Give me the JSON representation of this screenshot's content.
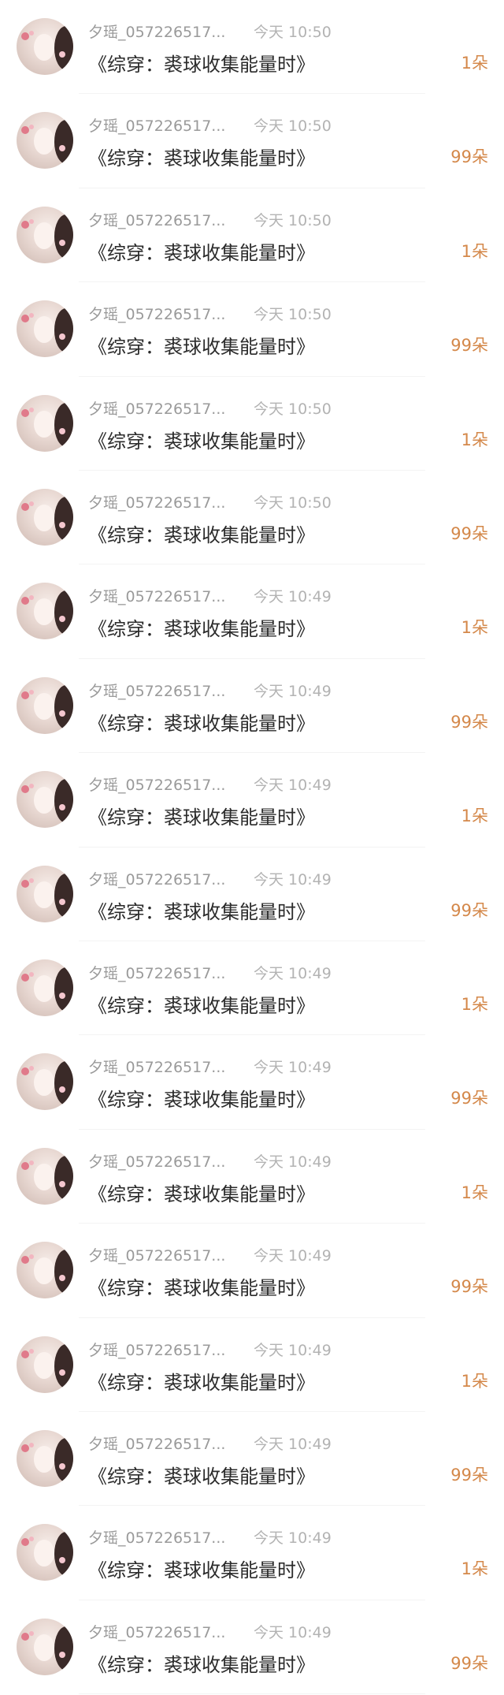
{
  "items": [
    {
      "username": "夕瑶_057226517...",
      "time": "今天 10:50",
      "title": "《综穿：裘球收集能量时》",
      "gift": "1朵"
    },
    {
      "username": "夕瑶_057226517...",
      "time": "今天 10:50",
      "title": "《综穿：裘球收集能量时》",
      "gift": "99朵"
    },
    {
      "username": "夕瑶_057226517...",
      "time": "今天 10:50",
      "title": "《综穿：裘球收集能量时》",
      "gift": "1朵"
    },
    {
      "username": "夕瑶_057226517...",
      "time": "今天 10:50",
      "title": "《综穿：裘球收集能量时》",
      "gift": "99朵"
    },
    {
      "username": "夕瑶_057226517...",
      "time": "今天 10:50",
      "title": "《综穿：裘球收集能量时》",
      "gift": "1朵"
    },
    {
      "username": "夕瑶_057226517...",
      "time": "今天 10:50",
      "title": "《综穿：裘球收集能量时》",
      "gift": "99朵"
    },
    {
      "username": "夕瑶_057226517...",
      "time": "今天 10:49",
      "title": "《综穿：裘球收集能量时》",
      "gift": "1朵"
    },
    {
      "username": "夕瑶_057226517...",
      "time": "今天 10:49",
      "title": "《综穿：裘球收集能量时》",
      "gift": "99朵"
    },
    {
      "username": "夕瑶_057226517...",
      "time": "今天 10:49",
      "title": "《综穿：裘球收集能量时》",
      "gift": "1朵"
    },
    {
      "username": "夕瑶_057226517...",
      "time": "今天 10:49",
      "title": "《综穿：裘球收集能量时》",
      "gift": "99朵"
    },
    {
      "username": "夕瑶_057226517...",
      "time": "今天 10:49",
      "title": "《综穿：裘球收集能量时》",
      "gift": "1朵"
    },
    {
      "username": "夕瑶_057226517...",
      "time": "今天 10:49",
      "title": "《综穿：裘球收集能量时》",
      "gift": "99朵"
    },
    {
      "username": "夕瑶_057226517...",
      "time": "今天 10:49",
      "title": "《综穿：裘球收集能量时》",
      "gift": "1朵"
    },
    {
      "username": "夕瑶_057226517...",
      "time": "今天 10:49",
      "title": "《综穿：裘球收集能量时》",
      "gift": "99朵"
    },
    {
      "username": "夕瑶_057226517...",
      "time": "今天 10:49",
      "title": "《综穿：裘球收集能量时》",
      "gift": "1朵"
    },
    {
      "username": "夕瑶_057226517...",
      "time": "今天 10:49",
      "title": "《综穿：裘球收集能量时》",
      "gift": "99朵"
    },
    {
      "username": "夕瑶_057226517...",
      "time": "今天 10:49",
      "title": "《综穿：裘球收集能量时》",
      "gift": "1朵"
    },
    {
      "username": "夕瑶_057226517...",
      "time": "今天 10:49",
      "title": "《综穿：裘球收集能量时》",
      "gift": "99朵"
    }
  ],
  "colors": {
    "gift_accent": "#d4884a",
    "username": "#9a9a9a",
    "time": "#b3b3b3",
    "title": "#2b2b2b"
  }
}
